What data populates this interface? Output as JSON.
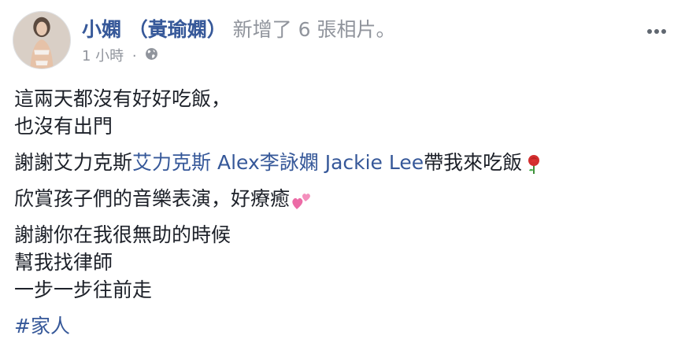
{
  "post": {
    "author": "小嫻 （黃瑜嫻）",
    "action": "新增了 6 張相片。",
    "time": "1 小時",
    "dot": "·",
    "audience_icon": "globe-icon",
    "menu_icon": "more-options-icon",
    "text": {
      "p1_line1": "這兩天都沒有好好吃飯，",
      "p1_line2": "也沒有出門",
      "p2_prefix": "謝謝艾力克斯",
      "p2_tag1": "艾力克斯 Alex",
      "p2_tag2": "李詠嫻 Jackie Lee",
      "p2_suffix": "帶我來吃飯",
      "p2_emoji": "rose-emoji",
      "p3": "欣賞孩子們的音樂表演，好療癒",
      "p3_emoji": "two-hearts-emoji",
      "p4_line1": "謝謝你在我很無助的時候",
      "p4_line2": "幫我找律師",
      "p4_line3": "一步一步往前走",
      "hashtag": "#家人"
    },
    "colors": {
      "link": "#365899",
      "text": "#1d2129",
      "meta": "#90949c"
    }
  }
}
